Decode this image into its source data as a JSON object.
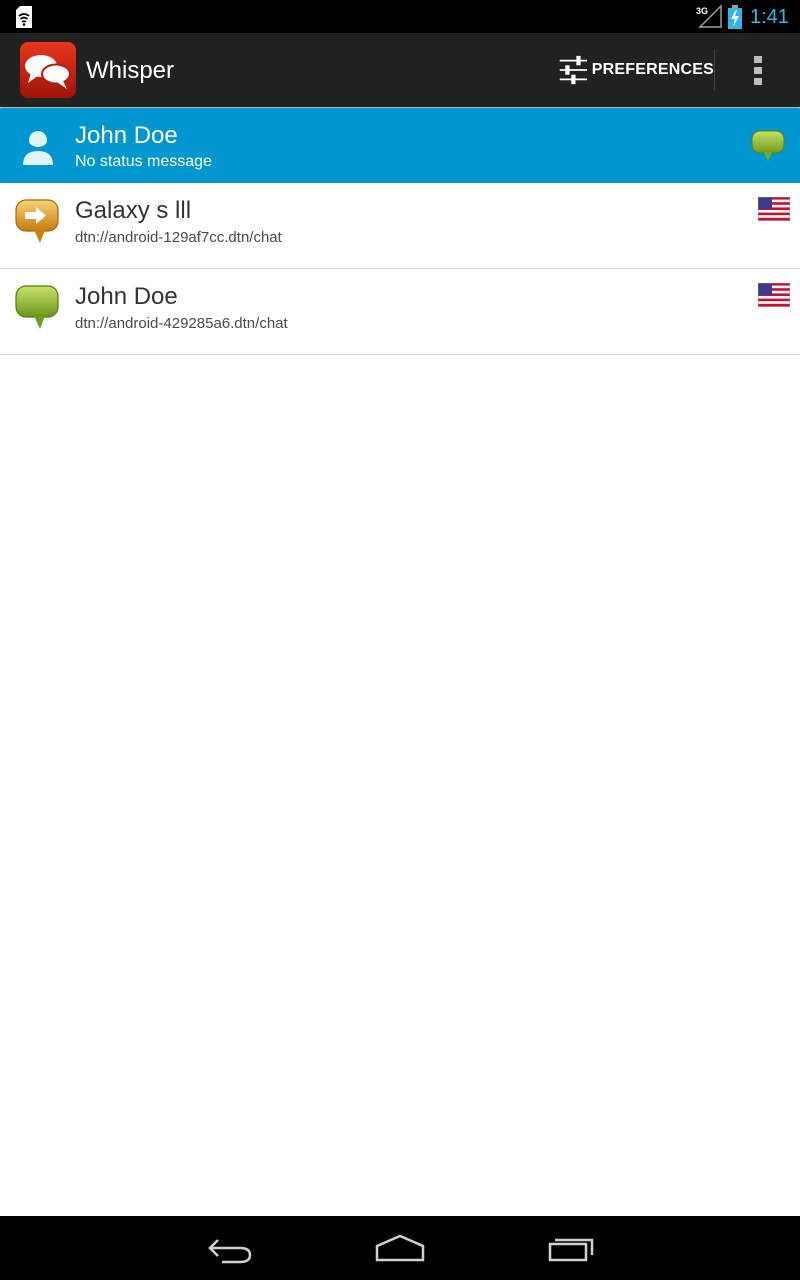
{
  "status_bar": {
    "network": "3G",
    "time": "1:41",
    "accent_color": "#33b5e5",
    "icons": [
      "wifi-lock-icon",
      "signal-3g-icon",
      "battery-charging-icon"
    ]
  },
  "action_bar": {
    "title": "Whisper",
    "preferences_label": "PREFERENCES",
    "icons": [
      "whisper-app-icon",
      "sliders-icon",
      "overflow-menu-icon"
    ]
  },
  "profile": {
    "name": "John Doe",
    "status": "No status message",
    "background_color": "#0096d0",
    "icons": [
      "person-icon",
      "green-speech-bubble-icon"
    ]
  },
  "buddies": [
    {
      "name": "Galaxy s lll",
      "endpoint": "dtn://android-129af7cc.dtn/chat",
      "presence_icon": "orange-arrow-bubble-icon",
      "country_icon": "us-flag-icon"
    },
    {
      "name": "John Doe",
      "endpoint": "dtn://android-429285a6.dtn/chat",
      "presence_icon": "green-speech-bubble-icon",
      "country_icon": "us-flag-icon"
    }
  ],
  "nav_bar": {
    "icons": [
      "back-icon",
      "home-icon",
      "recent-apps-icon"
    ]
  }
}
